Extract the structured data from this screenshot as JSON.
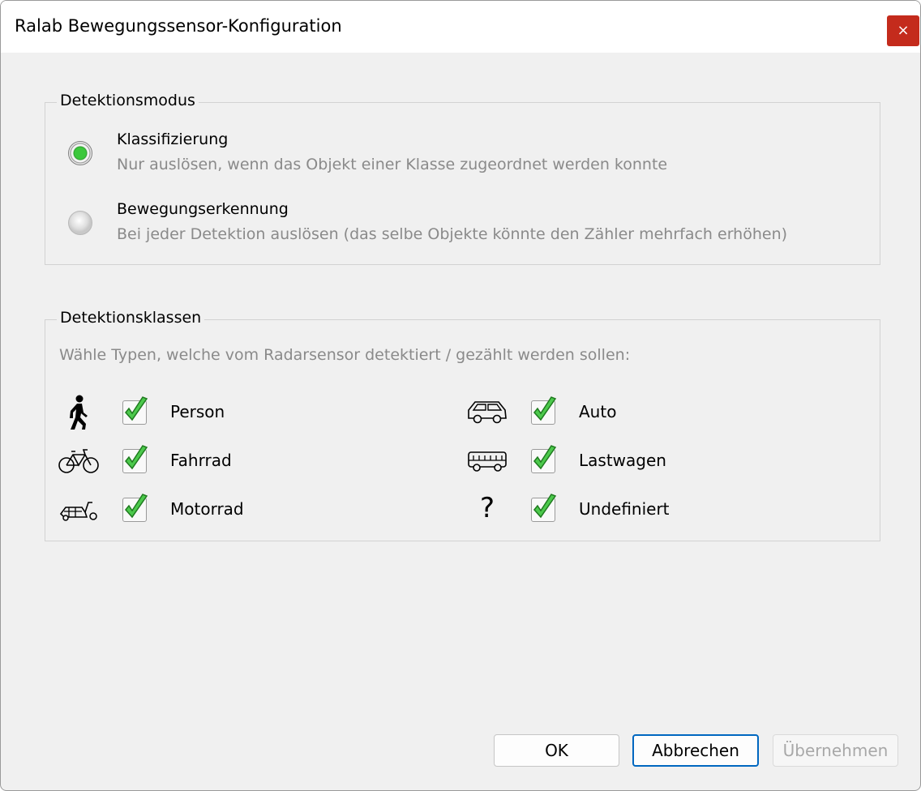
{
  "window": {
    "title": "Ralab Bewegungssensor-Konfiguration",
    "close_label": "×"
  },
  "mode_group": {
    "title": "Detektionsmodus",
    "options": [
      {
        "label": "Klassifizierung",
        "description": "Nur auslösen, wenn das Objekt einer Klasse zugeordnet werden konnte",
        "selected": true
      },
      {
        "label": "Bewegungserkennung",
        "description": "Bei jeder Detektion auslösen (das selbe Objekte könnte den Zähler mehrfach erhöhen)",
        "selected": false
      }
    ]
  },
  "classes_group": {
    "title": "Detektionsklassen",
    "hint": "Wähle Typen, welche vom Radarsensor detektiert / gezählt werden sollen:",
    "classes": [
      {
        "label": "Person",
        "icon": "person-walking-icon",
        "checked": true
      },
      {
        "label": "Auto",
        "icon": "car-icon",
        "checked": true
      },
      {
        "label": "Fahrrad",
        "icon": "bicycle-icon",
        "checked": true
      },
      {
        "label": "Lastwagen",
        "icon": "truck-icon",
        "checked": true
      },
      {
        "label": "Motorrad",
        "icon": "motorcycle-icon",
        "checked": true
      },
      {
        "label": "Undefiniert",
        "icon": "question-mark-icon",
        "glyph": "?",
        "checked": true
      }
    ]
  },
  "buttons": {
    "ok": "OK",
    "cancel": "Abbrechen",
    "apply": "Übernehmen"
  }
}
